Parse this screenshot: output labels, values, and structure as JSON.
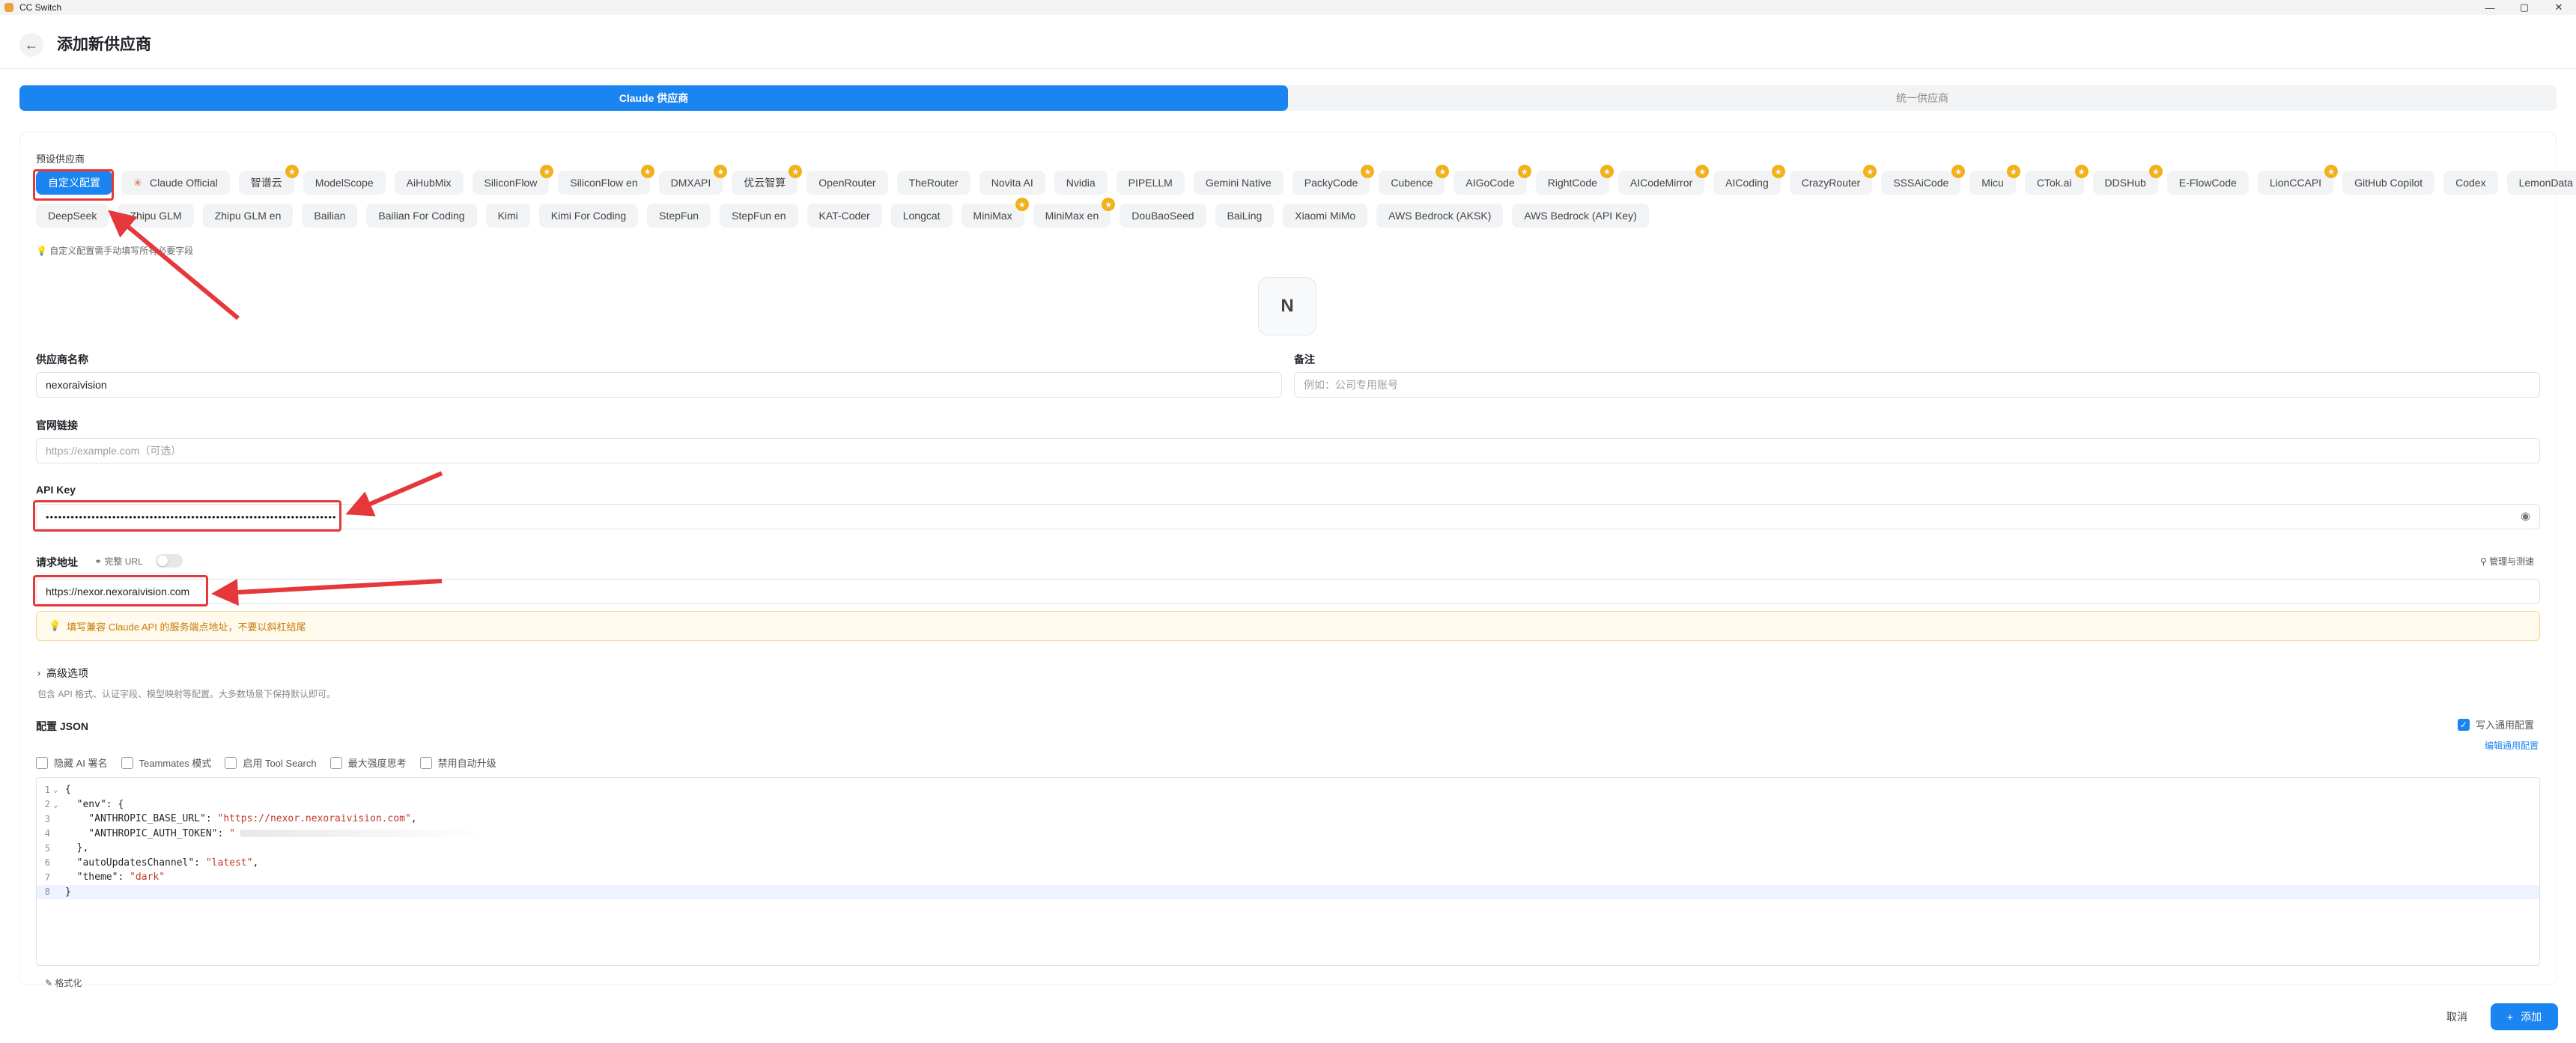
{
  "window": {
    "title": "CC Switch",
    "minimize": "—",
    "maximize": "▢",
    "close": "✕"
  },
  "header": {
    "back": "←",
    "title": "添加新供应商"
  },
  "tabs": [
    {
      "label": "Claude 供应商",
      "active": true
    },
    {
      "label": "统一供应商",
      "active": false
    }
  ],
  "presets": {
    "label": "预设供应商",
    "row1": [
      {
        "label": "自定义配置",
        "selected": true,
        "star": false
      },
      {
        "label": "Claude Official",
        "selected": false,
        "star": false,
        "logo": true
      },
      {
        "label": "智谱云",
        "star": true
      },
      {
        "label": "ModelScope",
        "star": false
      },
      {
        "label": "AiHubMix",
        "star": false
      },
      {
        "label": "SiliconFlow",
        "star": true
      },
      {
        "label": "SiliconFlow en",
        "star": true
      },
      {
        "label": "DMXAPI",
        "star": true
      },
      {
        "label": "优云智算",
        "star": true
      },
      {
        "label": "OpenRouter",
        "star": false
      },
      {
        "label": "TheRouter",
        "star": false
      },
      {
        "label": "Novita AI",
        "star": false
      },
      {
        "label": "Nvidia",
        "star": false
      },
      {
        "label": "PIPELLM",
        "star": false
      },
      {
        "label": "Gemini Native",
        "star": false
      },
      {
        "label": "PackyCode",
        "star": true
      },
      {
        "label": "Cubence",
        "star": true
      },
      {
        "label": "AIGoCode",
        "star": true
      },
      {
        "label": "RightCode",
        "star": true
      },
      {
        "label": "AICodeMirror",
        "star": true
      },
      {
        "label": "AICoding",
        "star": true
      },
      {
        "label": "CrazyRouter",
        "star": true
      },
      {
        "label": "SSSAiCode",
        "star": true
      },
      {
        "label": "Micu",
        "star": true
      },
      {
        "label": "CTok.ai",
        "star": true
      },
      {
        "label": "DDSHub",
        "star": true
      },
      {
        "label": "E-FlowCode",
        "star": false
      },
      {
        "label": "LionCCAPI",
        "star": true
      },
      {
        "label": "GitHub Copilot",
        "star": false
      },
      {
        "label": "Codex",
        "star": false
      },
      {
        "label": "LemonData",
        "star": true
      }
    ],
    "row2": [
      {
        "label": "DeepSeek",
        "star": false
      },
      {
        "label": "Zhipu GLM",
        "star": false
      },
      {
        "label": "Zhipu GLM en",
        "star": false
      },
      {
        "label": "Bailian",
        "star": false
      },
      {
        "label": "Bailian For Coding",
        "star": false
      },
      {
        "label": "Kimi",
        "star": false
      },
      {
        "label": "Kimi For Coding",
        "star": false
      },
      {
        "label": "StepFun",
        "star": false
      },
      {
        "label": "StepFun en",
        "star": false
      },
      {
        "label": "KAT-Coder",
        "star": false
      },
      {
        "label": "Longcat",
        "star": false
      },
      {
        "label": "MiniMax",
        "star": true
      },
      {
        "label": "MiniMax en",
        "star": true
      },
      {
        "label": "DouBaoSeed",
        "star": false
      },
      {
        "label": "BaiLing",
        "star": false
      },
      {
        "label": "Xiaomi MiMo",
        "star": false
      },
      {
        "label": "AWS Bedrock (AKSK)",
        "star": false
      },
      {
        "label": "AWS Bedrock (API Key)",
        "star": false
      }
    ],
    "hint": "自定义配置需手动填写所有必要字段"
  },
  "avatar": {
    "letter": "N"
  },
  "form": {
    "name_label": "供应商名称",
    "name_value": "nexoraivision",
    "note_label": "备注",
    "note_placeholder": "例如：公司专用账号",
    "site_label": "官网链接",
    "site_placeholder": "https://example.com（可选）",
    "apikey_label": "API Key",
    "apikey_value": "••••••••••••••••••••••••••••••••••••••••••••••••••••••••••••••••••••••",
    "endpoint_label": "请求地址",
    "full_url_label": "完整 URL",
    "manage_label": "管理与测速",
    "endpoint_value": "https://nexor.nexoraivision.com",
    "endpoint_notice": "填写兼容 Claude API 的服务端点地址，不要以斜杠结尾"
  },
  "advanced": {
    "label": "高级选项",
    "hint": "包含 API 格式、认证字段、模型映射等配置。大多数场景下保持默认即可。"
  },
  "config": {
    "label": "配置 JSON",
    "write_common_label": "写入通用配置",
    "edit_common_link": "编辑通用配置",
    "options": [
      "隐藏 AI 署名",
      "Teammates 模式",
      "启用 Tool Search",
      "最大强度思考",
      "禁用自动升级"
    ],
    "lines": [
      {
        "n": "1",
        "fold": "⌄",
        "text": "{"
      },
      {
        "n": "2",
        "fold": "⌄",
        "key": "  \"env\": {",
        "str": ""
      },
      {
        "n": "3",
        "fold": "",
        "key": "    \"ANTHROPIC_BASE_URL\": ",
        "str": "\"https://nexor.nexoraivision.com\"",
        "tail": ","
      },
      {
        "n": "4",
        "fold": "",
        "key": "    \"ANTHROPIC_AUTH_TOKEN\": ",
        "str": "\"",
        "redacted": true
      },
      {
        "n": "5",
        "fold": "",
        "key": "  },",
        "str": ""
      },
      {
        "n": "6",
        "fold": "",
        "key": "  \"autoUpdatesChannel\": ",
        "str": "\"latest\"",
        "tail": ","
      },
      {
        "n": "7",
        "fold": "",
        "key": "  \"theme\": ",
        "str": "\"dark\""
      },
      {
        "n": "8",
        "fold": "",
        "text": "}"
      }
    ],
    "format_label": "格式化"
  },
  "footer": {
    "cancel": "取消",
    "add": "添加"
  },
  "colors": {
    "accent": "#1a84f0",
    "annotation": "#e5383b",
    "star": "#f2b11b"
  }
}
